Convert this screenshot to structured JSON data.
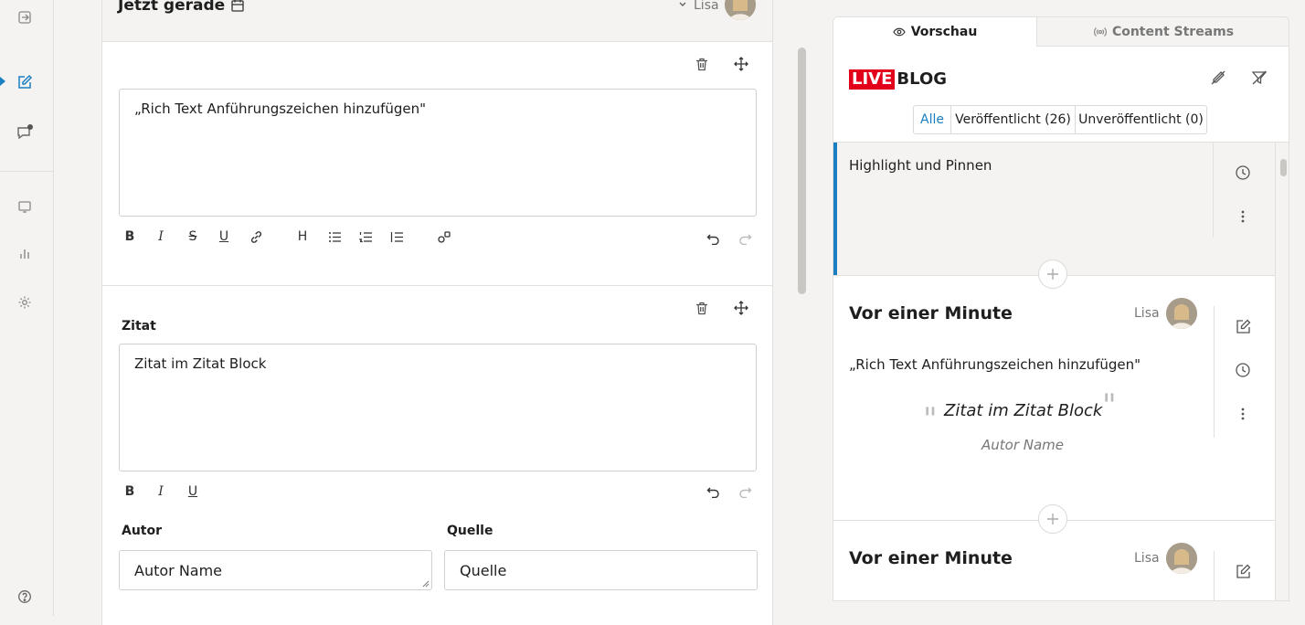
{
  "editor": {
    "entry_title": "Jetzt gerade",
    "author": "Lisa",
    "block1": {
      "text": "„Rich Text Anführungszeichen hinzufügen\""
    },
    "block2": {
      "label": "Zitat",
      "quote_text": "Zitat im Zitat Block",
      "author_label": "Autor",
      "author_value": "Autor Name",
      "source_label": "Quelle",
      "source_value": "Quelle"
    },
    "toolbar": {
      "bold": "B",
      "italic": "I",
      "strike": "S",
      "underline": "U",
      "heading": "H"
    }
  },
  "preview": {
    "tabs": [
      "Vorschau",
      "Content Streams"
    ],
    "logo_live": "LIVE",
    "logo_blog": "BLOG",
    "filters": [
      "Alle",
      "Veröffentlicht (26)",
      "Unveröffentlicht (0)"
    ],
    "pinned_text": "Highlight und Pinnen",
    "posts": [
      {
        "time": "Vor einer Minute",
        "author": "Lisa",
        "text": "„Rich Text Anführungszeichen hinzufügen\"",
        "quote": "Zitat im Zitat Block",
        "quote_author": "Autor Name"
      },
      {
        "time": "Vor einer Minute",
        "author": "Lisa"
      }
    ]
  },
  "colors": {
    "accent": "#1a7fc1",
    "live_red": "#e3001b"
  }
}
